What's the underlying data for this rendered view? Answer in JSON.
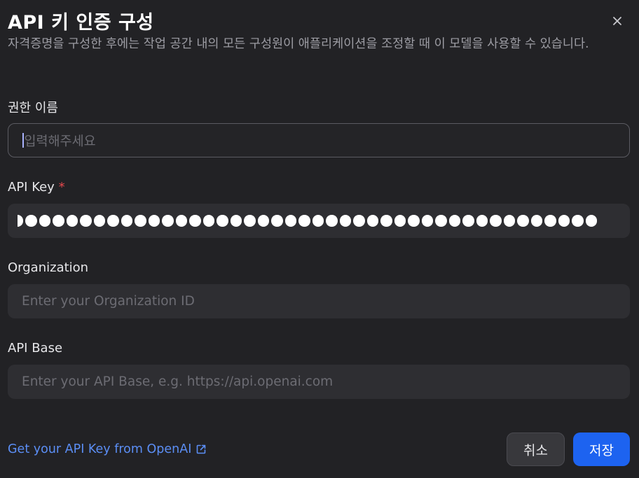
{
  "dialog": {
    "title": "API 키 인증 구성",
    "description": "자격증명을 구성한 후에는 작업 공간 내의 모든 구성원이 애플리케이션을 조정할 때 이 모델을 사용할 수 있습니다.",
    "close_icon": "close-icon"
  },
  "fields": {
    "name": {
      "label": "권한 이름",
      "placeholder": "입력해주세요",
      "value": ""
    },
    "api_key": {
      "label": "API Key",
      "required_mark": "*",
      "value_masked": true
    },
    "organization": {
      "label": "Organization",
      "placeholder": "Enter your Organization ID",
      "value": ""
    },
    "api_base": {
      "label": "API Base",
      "placeholder": "Enter your API Base, e.g. https://api.openai.com",
      "value": ""
    }
  },
  "footer": {
    "link_label": "Get your API Key from OpenAI",
    "link_icon": "external-link-icon",
    "cancel_label": "취소",
    "save_label": "저장"
  },
  "colors": {
    "background": "#222225",
    "input_bg": "#2e2e32",
    "primary": "#1d63f0",
    "link": "#5b8ef5",
    "required": "#e5484d"
  }
}
